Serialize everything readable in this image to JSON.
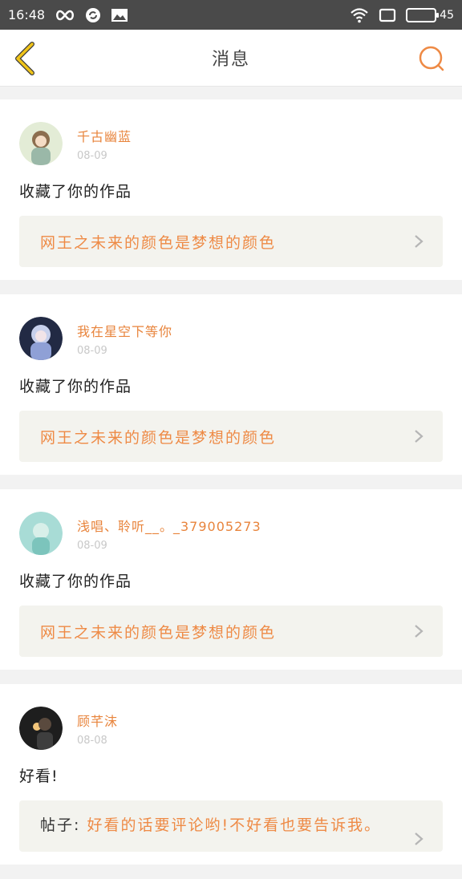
{
  "status_bar": {
    "time": "16:48",
    "icons_left": [
      "infinity-icon",
      "sync-icon",
      "image-icon"
    ],
    "icons_right": [
      "wifi-icon",
      "tablet-icon",
      "battery-icon"
    ],
    "battery_level": "45"
  },
  "nav": {
    "title": "消息",
    "back_icon": "chevron-left-icon",
    "search_icon": "search-icon"
  },
  "messages": [
    {
      "user": "千古幽蓝",
      "date": "08-09",
      "action": "收藏了你的作品",
      "target": "网王之未来的颜色是梦想的颜色",
      "avatar_color": "#cfe0c8"
    },
    {
      "user": "我在星空下等你",
      "date": "08-09",
      "action": "收藏了你的作品",
      "target": "网王之未来的颜色是梦想的颜色",
      "avatar_color": "#7b8fc9"
    },
    {
      "user": "浅唱、聆听__。_379005273",
      "date": "08-09",
      "action": "收藏了你的作品",
      "target": "网王之未来的颜色是梦想的颜色",
      "avatar_color": "#9fd8d4"
    },
    {
      "user": "顾芊沫",
      "date": "08-08",
      "action": "好看!",
      "post_prefix": "帖子:",
      "target": "好看的话要评论哟!不好看也要告诉我。",
      "avatar_color": "#3a3a3a"
    }
  ],
  "colors": {
    "accent": "#ee8a45",
    "username": "#e8843c",
    "back_arrow": "#f0c419",
    "status_bar": "#4a4a4a"
  }
}
